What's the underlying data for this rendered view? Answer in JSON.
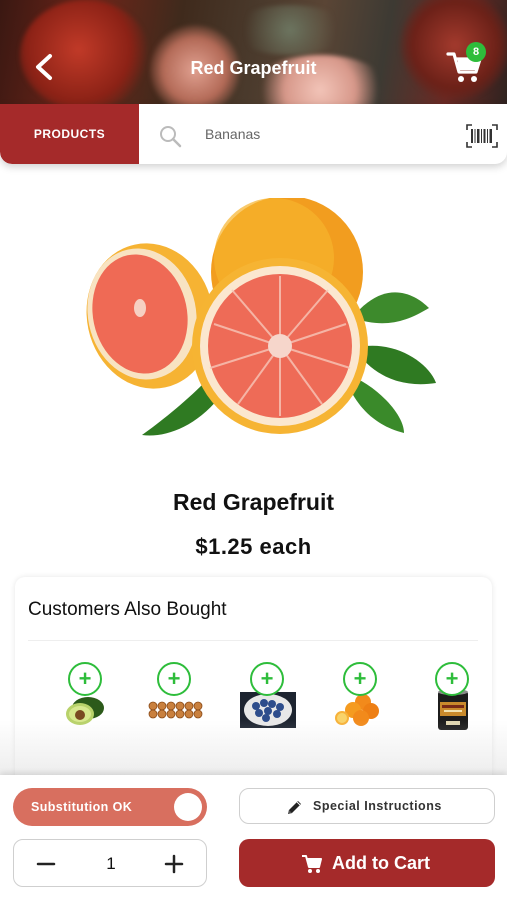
{
  "header": {
    "title": "Red Grapefruit",
    "back_icon": "chevron-left-icon",
    "cart_icon": "shopping-cart-icon",
    "cart_count": "8"
  },
  "search": {
    "tab_label": "PRODUCTS",
    "placeholder": "Bananas",
    "value": "",
    "search_icon": "search-icon",
    "barcode_icon": "barcode-icon"
  },
  "product": {
    "name": "Red Grapefruit",
    "price": "$1.25 each",
    "image": "grapefruit-image"
  },
  "also_bought": {
    "title": "Customers Also Bought",
    "items": [
      {
        "icon": "avocado-image",
        "add_label": "+"
      },
      {
        "icon": "eggs-image",
        "add_label": "+"
      },
      {
        "icon": "blueberries-image",
        "add_label": "+"
      },
      {
        "icon": "oranges-image",
        "add_label": "+"
      },
      {
        "icon": "soup-can-image",
        "add_label": "+"
      }
    ]
  },
  "bottom": {
    "substitution_label": "Substitution OK",
    "substitution_on": true,
    "special_label": "Special Instructions",
    "quantity": "1",
    "add_label": "Add to Cart"
  },
  "colors": {
    "brand_red": "#a52a2a",
    "toggle": "#d86f5f",
    "accent_green": "#2ebd3b"
  }
}
